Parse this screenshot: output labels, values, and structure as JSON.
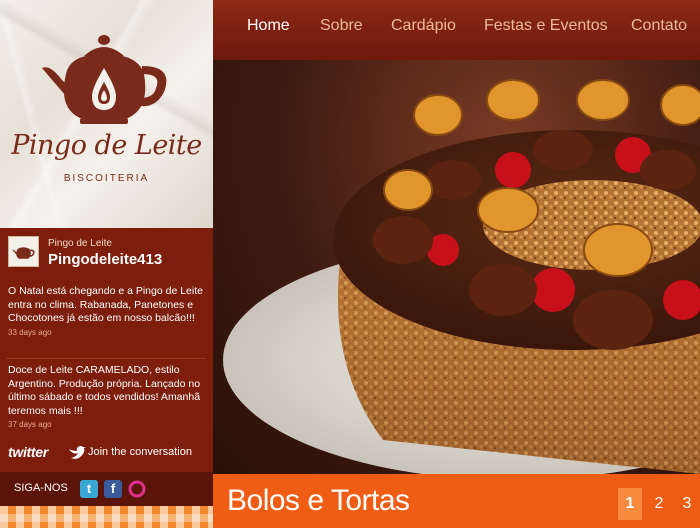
{
  "brand": {
    "name": "Pingo de Leite",
    "tagline": "BISCOITERIA"
  },
  "nav": {
    "items": [
      "Home",
      "Sobre",
      "Cardápio",
      "Festas e Eventos",
      "Contato"
    ],
    "active": "Home"
  },
  "twitter_widget": {
    "display_name": "Pingo de Leite",
    "handle": "Pingodeleite413",
    "tweets": [
      {
        "text": "O Natal está chegando e a Pingo de Leite entra no clima. Rabanada, Panetones e Chocotones já estão em nosso balcão!!!",
        "time": "33 days ago"
      },
      {
        "text": "Doce de Leite CARAMELADO, estilo Argentino. Produção própria. Lançado no último sábado e todos vendidos! Amanhã teremos mais !!!",
        "time": "37 days ago"
      }
    ],
    "logo_text": "twitter",
    "join_text": "Join the conversation"
  },
  "social": {
    "label": "SIGA-NOS",
    "icons": [
      "twitter-icon",
      "facebook-icon",
      "orkut-icon"
    ]
  },
  "hero": {
    "caption": "Bolos e Tortas"
  },
  "pagination": {
    "pages": [
      "1",
      "2",
      "3"
    ],
    "current": "1"
  },
  "colors": {
    "sidebar": "#7d1e0c",
    "nav": "#7a1e10",
    "caption_bar": "#ee5d13",
    "brand_text": "#7a2a1a"
  }
}
